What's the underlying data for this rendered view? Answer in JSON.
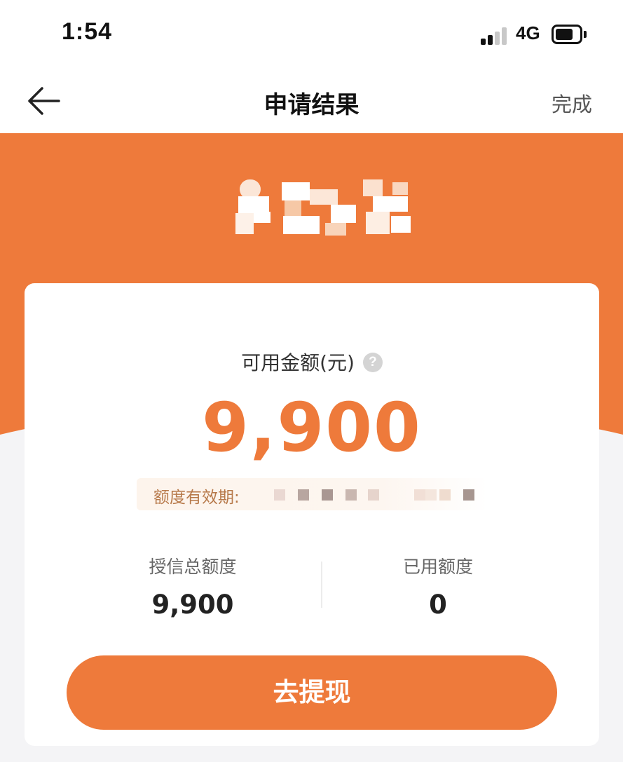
{
  "status_bar": {
    "time": "1:54",
    "network": "4G",
    "signal_icon": "signal-bars-icon",
    "battery_icon": "battery-icon"
  },
  "nav": {
    "back_icon": "arrow-left-icon",
    "title": "申请结果",
    "done_label": "完成"
  },
  "banner": {
    "logo": "pixelated-logo"
  },
  "card": {
    "available_label": "可用金额(元)",
    "help_glyph": "?",
    "available_amount": "9,900",
    "validity_label": "额度有效期:",
    "stats": {
      "total_label": "授信总额度",
      "total_value": "9,900",
      "used_label": "已用额度",
      "used_value": "0"
    },
    "withdraw_label": "去提现"
  },
  "colors": {
    "accent": "#ee7a3b",
    "validity_text": "#b7794a",
    "page_bg": "#f4f4f6"
  }
}
